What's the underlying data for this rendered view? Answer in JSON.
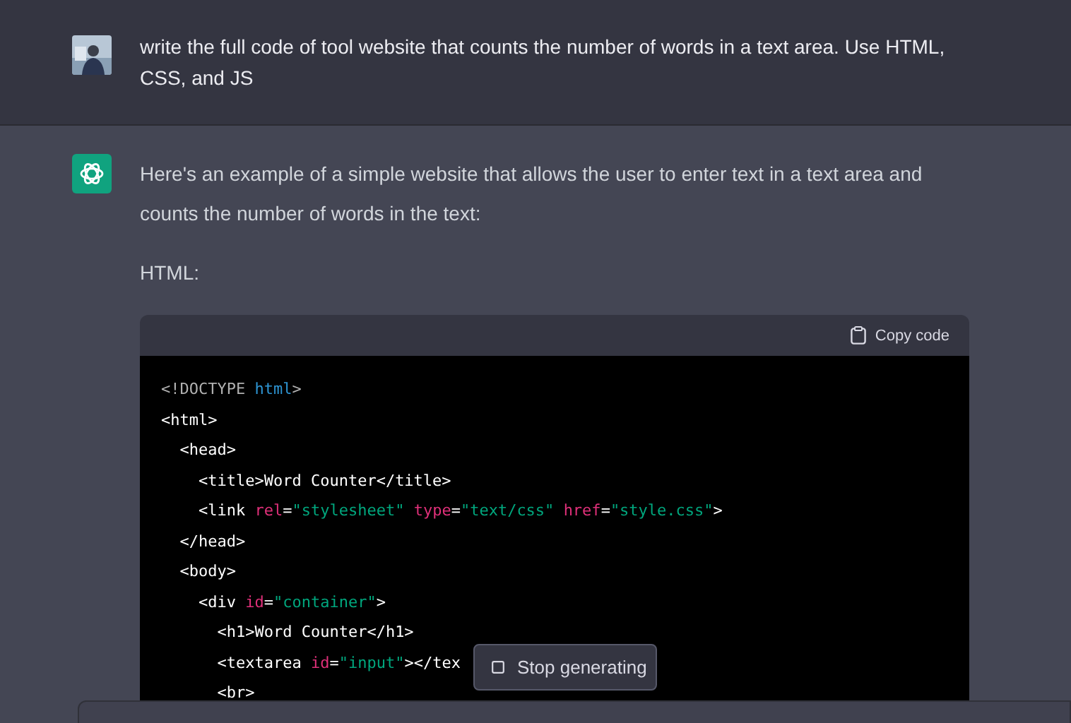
{
  "user_message": {
    "text": "write the full code of tool website that counts the number of words in a text area. Use HTML, CSS, and JS"
  },
  "assistant_message": {
    "paragraphs": [
      "Here's an example of a simple website that allows the user to enter text in a text area and counts the number of words in the text:",
      "HTML:"
    ],
    "code_block": {
      "copy_label": "Copy code",
      "lines": [
        [
          {
            "kind": "doctype",
            "text": "<!DOCTYPE "
          },
          {
            "kind": "keyword",
            "text": "html"
          },
          {
            "kind": "doctype",
            "text": ">"
          }
        ],
        [
          {
            "kind": "tag",
            "text": "<html>"
          }
        ],
        [
          {
            "kind": "tag",
            "text": "  <head>"
          }
        ],
        [
          {
            "kind": "tag",
            "text": "    <title>Word Counter</title>"
          }
        ],
        [
          {
            "kind": "tag",
            "text": "    <link "
          },
          {
            "kind": "attr",
            "text": "rel"
          },
          {
            "kind": "tag",
            "text": "="
          },
          {
            "kind": "string",
            "text": "\"stylesheet\" "
          },
          {
            "kind": "attr",
            "text": "type"
          },
          {
            "kind": "tag",
            "text": "="
          },
          {
            "kind": "string",
            "text": "\"text/css\" "
          },
          {
            "kind": "attr",
            "text": "href"
          },
          {
            "kind": "tag",
            "text": "="
          },
          {
            "kind": "string",
            "text": "\"style.css\""
          },
          {
            "kind": "tag",
            "text": ">"
          }
        ],
        [
          {
            "kind": "tag",
            "text": "  </head>"
          }
        ],
        [
          {
            "kind": "tag",
            "text": "  <body>"
          }
        ],
        [
          {
            "kind": "tag",
            "text": "    <div "
          },
          {
            "kind": "attr",
            "text": "id"
          },
          {
            "kind": "tag",
            "text": "="
          },
          {
            "kind": "string",
            "text": "\"container\""
          },
          {
            "kind": "tag",
            "text": ">"
          }
        ],
        [
          {
            "kind": "tag",
            "text": "      <h1>Word Counter</h1>"
          }
        ],
        [
          {
            "kind": "tag",
            "text": "      <textarea "
          },
          {
            "kind": "attr",
            "text": "id"
          },
          {
            "kind": "tag",
            "text": "="
          },
          {
            "kind": "string",
            "text": "\"input\""
          },
          {
            "kind": "tag",
            "text": "></tex"
          }
        ],
        [
          {
            "kind": "tag",
            "text": "      <br>"
          }
        ]
      ]
    }
  },
  "stop_button": {
    "label": "Stop generating"
  }
}
